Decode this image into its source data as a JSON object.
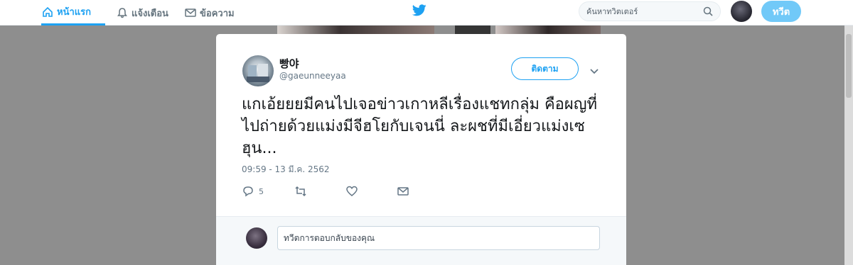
{
  "nav": {
    "home_label": "หน้าแรก",
    "notifications_label": "แจ้งเตือน",
    "messages_label": "ข้อความ",
    "search_placeholder": "ค้นหาทวิตเตอร์",
    "tweet_button": "ทวีต"
  },
  "tweet": {
    "display_name": "빵야",
    "handle": "@gaeunneeyaa",
    "follow_label": "ติดตาม",
    "text": "แกเอ้ยยยมีคนไปเจอข่าวเกาหลีเรื่องแชทกลุ่ม คือผญที่ไปถ่ายด้วยแม่งมีจีฮโยกับเจนนี่ ละผชที่มีเอี่ยวแม่งเซฮุน...",
    "timestamp": "09:59 - 13 มี.ค. 2562",
    "reply_count": "5"
  },
  "reply": {
    "placeholder": "ทวีตการตอบกลับของคุณ"
  },
  "colors": {
    "accent": "#1da1f2",
    "overlay": "#8e8e8e",
    "tweet_button_bg": "#71c9f8"
  },
  "icons": [
    "home-icon",
    "bell-icon",
    "envelope-icon",
    "twitter-bird-icon",
    "search-icon",
    "close-icon",
    "chevron-down-icon",
    "reply-icon",
    "retweet-icon",
    "heart-icon",
    "dm-icon"
  ]
}
